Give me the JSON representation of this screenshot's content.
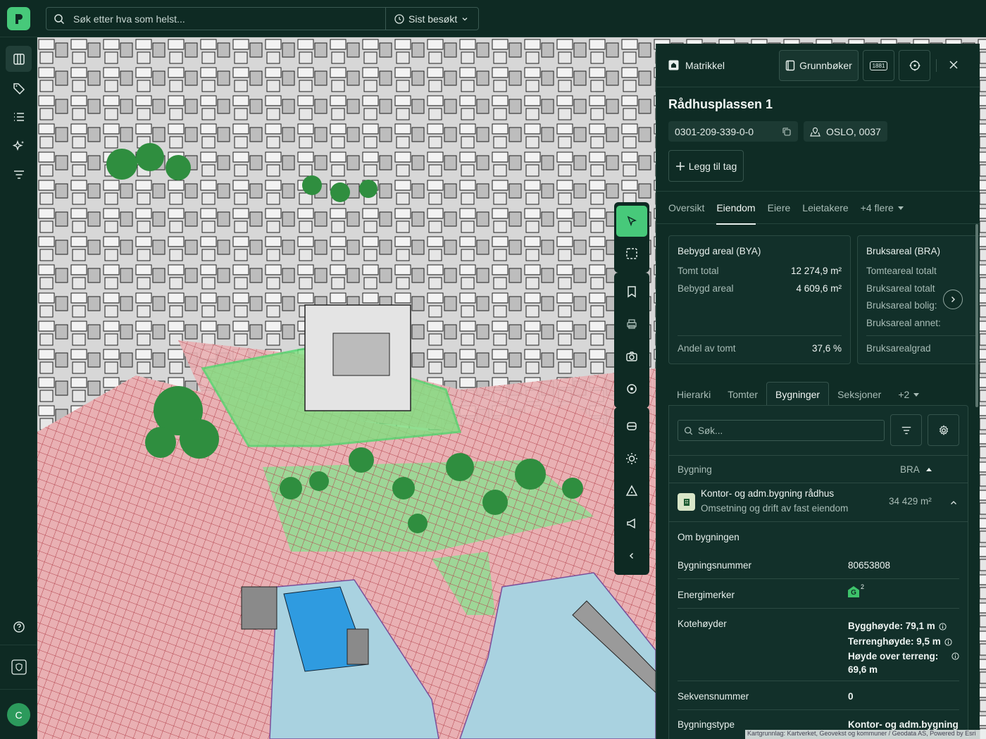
{
  "topbar": {
    "search_placeholder": "Søk etter hva som helst...",
    "recent_label": "Sist besøkt"
  },
  "rail": {
    "items": [
      "map-layers",
      "tags",
      "list",
      "ai-sparkles",
      "filter"
    ],
    "avatar_initial": "C"
  },
  "map": {
    "attribution": "Kartgrunnlag: Kartverket, Geovekst og kommuner / Geodata AS, Powered by Esri",
    "colors": {
      "water": "#a9d2e0",
      "zoning": "#e9a9ae",
      "park": "#9ee49a",
      "selection": "#4cd96b"
    }
  },
  "panel": {
    "header": {
      "title": "Matrikkel",
      "grunnboker_label": "Grunnbøker",
      "badge_1881": "1881"
    },
    "address": "Rådhusplassen 1",
    "matrikkel_id": "0301-209-339-0-0",
    "location": "OSLO, 0037",
    "add_tag_label": "Legg til tag",
    "tabs": [
      "Oversikt",
      "Eiendom",
      "Eiere",
      "Leietakere",
      "+4 flere"
    ],
    "active_tab": "Eiendom",
    "cards": {
      "bya": {
        "title": "Bebygd areal (BYA)",
        "rows": [
          {
            "label": "Tomt total",
            "value": "12 274,9 m²"
          },
          {
            "label": "Bebygd areal",
            "value": "4 609,6 m²"
          }
        ],
        "footer_label": "Andel av tomt",
        "footer_value": "37,6 %"
      },
      "bra": {
        "title": "Bruksareal (BRA)",
        "rows": [
          "Tomteareal totalt",
          "Bruksareal totalt",
          "Bruksareal bolig:",
          "Bruksareal annet:"
        ],
        "footer_label": "Bruksarealgrad"
      }
    },
    "subtabs": [
      "Hierarki",
      "Tomter",
      "Bygninger",
      "Seksjoner",
      "+2"
    ],
    "active_subtab": "Bygninger",
    "building_search_placeholder": "Søk...",
    "table": {
      "col_building": "Bygning",
      "col_bra": "BRA"
    },
    "building": {
      "name": "Kontor- og adm.bygning rådhus",
      "usage": "Omsetning og drift av fast eiendom",
      "bra": "34 429 m²"
    },
    "details": {
      "section_title": "Om bygningen",
      "building_number_label": "Bygningsnummer",
      "building_number": "80653808",
      "energy_label": "Energimerker",
      "energy_grade": "G",
      "energy_count": "2",
      "heights_label": "Kotehøyder",
      "building_height": "Bygghøyde: 79,1 m",
      "terrain_height": "Terrenghøyde: 9,5 m",
      "height_above_terrain": "Høyde over terreng:",
      "height_above_terrain_value": "69,6 m",
      "sequence_label": "Sekvensnummer",
      "sequence_value": "0",
      "type_label": "Bygningstype",
      "type_value": "Kontor- og adm.bygning"
    }
  }
}
